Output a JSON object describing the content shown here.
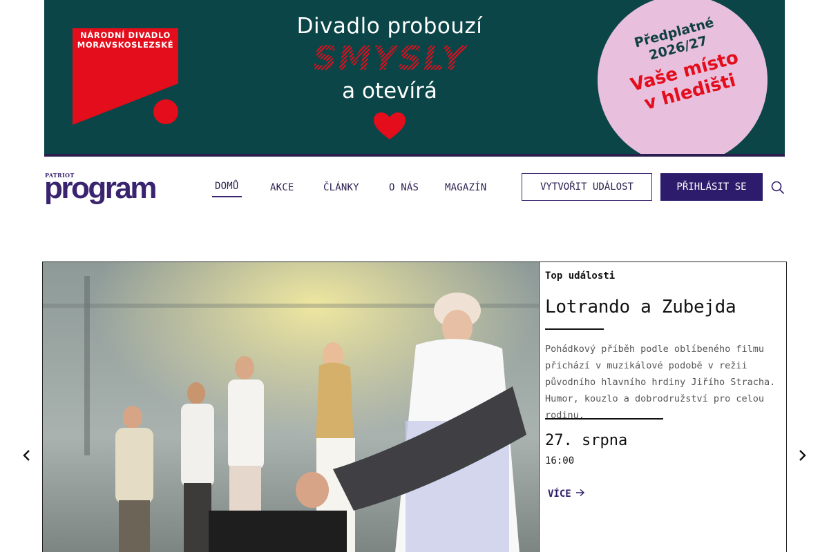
{
  "banner": {
    "org_line1": "NÁRODNÍ DIVADLO",
    "org_line2": "MORAVSKOSLEZSKÉ",
    "headline1": "Divadlo probouzí",
    "headline2": "SMYSLY",
    "headline3": "a otevírá",
    "circle_sub1": "Předplatné",
    "circle_sub2": "2026/27",
    "circle_big1": "Vaše místo",
    "circle_big2": "v hledišti",
    "colors": {
      "background": "#0b4547",
      "accent_red": "#e30d1b",
      "circle_pink": "#e8bfdd"
    }
  },
  "header": {
    "logo_small": "PATRIOT",
    "logo_big": "program",
    "nav": [
      {
        "label": "DOMŮ",
        "active": true
      },
      {
        "label": "AKCE",
        "active": false
      },
      {
        "label": "ČLÁNKY",
        "active": false
      },
      {
        "label": "O NÁS",
        "active": false
      },
      {
        "label": "MAGAZÍN",
        "active": false
      }
    ],
    "create_event": "VYTVOŘIT UDÁLOST",
    "login": "PŘIHLÁSIT SE",
    "search_icon": "search-icon",
    "brand_color": "#2d1b6b"
  },
  "hero": {
    "kicker": "Top události",
    "title": "Lotrando a Zubejda",
    "description": "Pohádkový příběh podle oblíbeného filmu přichází v muzikálové podobě v režii původního hlavního hrdiny Jiřího Stracha. Humor, kouzlo a dobrodružství pro celou rodinu.",
    "date": "27. srpna",
    "time": "16:00",
    "more": "VÍCE"
  }
}
